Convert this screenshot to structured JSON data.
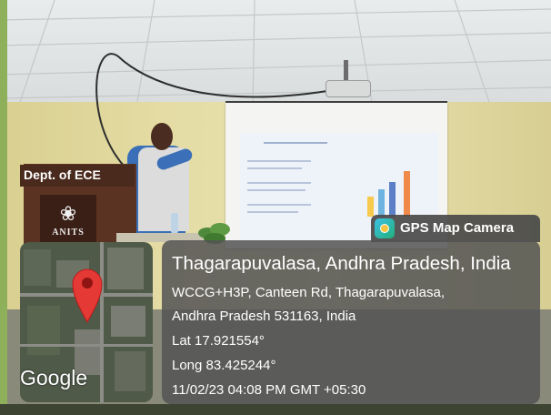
{
  "scene": {
    "podium_label": "Dept. of ECE",
    "podium_logo_text": "ANITS",
    "colors": {
      "overlay": "#545454",
      "wall": "#e4dca4",
      "podium": "#5b3323",
      "shirt": "#3b6fb7",
      "pin": "#e53935"
    }
  },
  "gps_overlay": {
    "app_name": "GPS Map Camera",
    "app_icon": "camera-icon",
    "map_attribution": "Google",
    "location_title": "Thagarapuvalasa, Andhra Pradesh, India",
    "address_line_1": "WCCG+H3P, Canteen Rd, Thagarapuvalasa,",
    "address_line_2": "Andhra Pradesh 531163, India",
    "latitude": "Lat 17.921554°",
    "longitude": "Long 83.425244°",
    "timestamp": "11/02/23 04:08 PM GMT +05:30"
  }
}
